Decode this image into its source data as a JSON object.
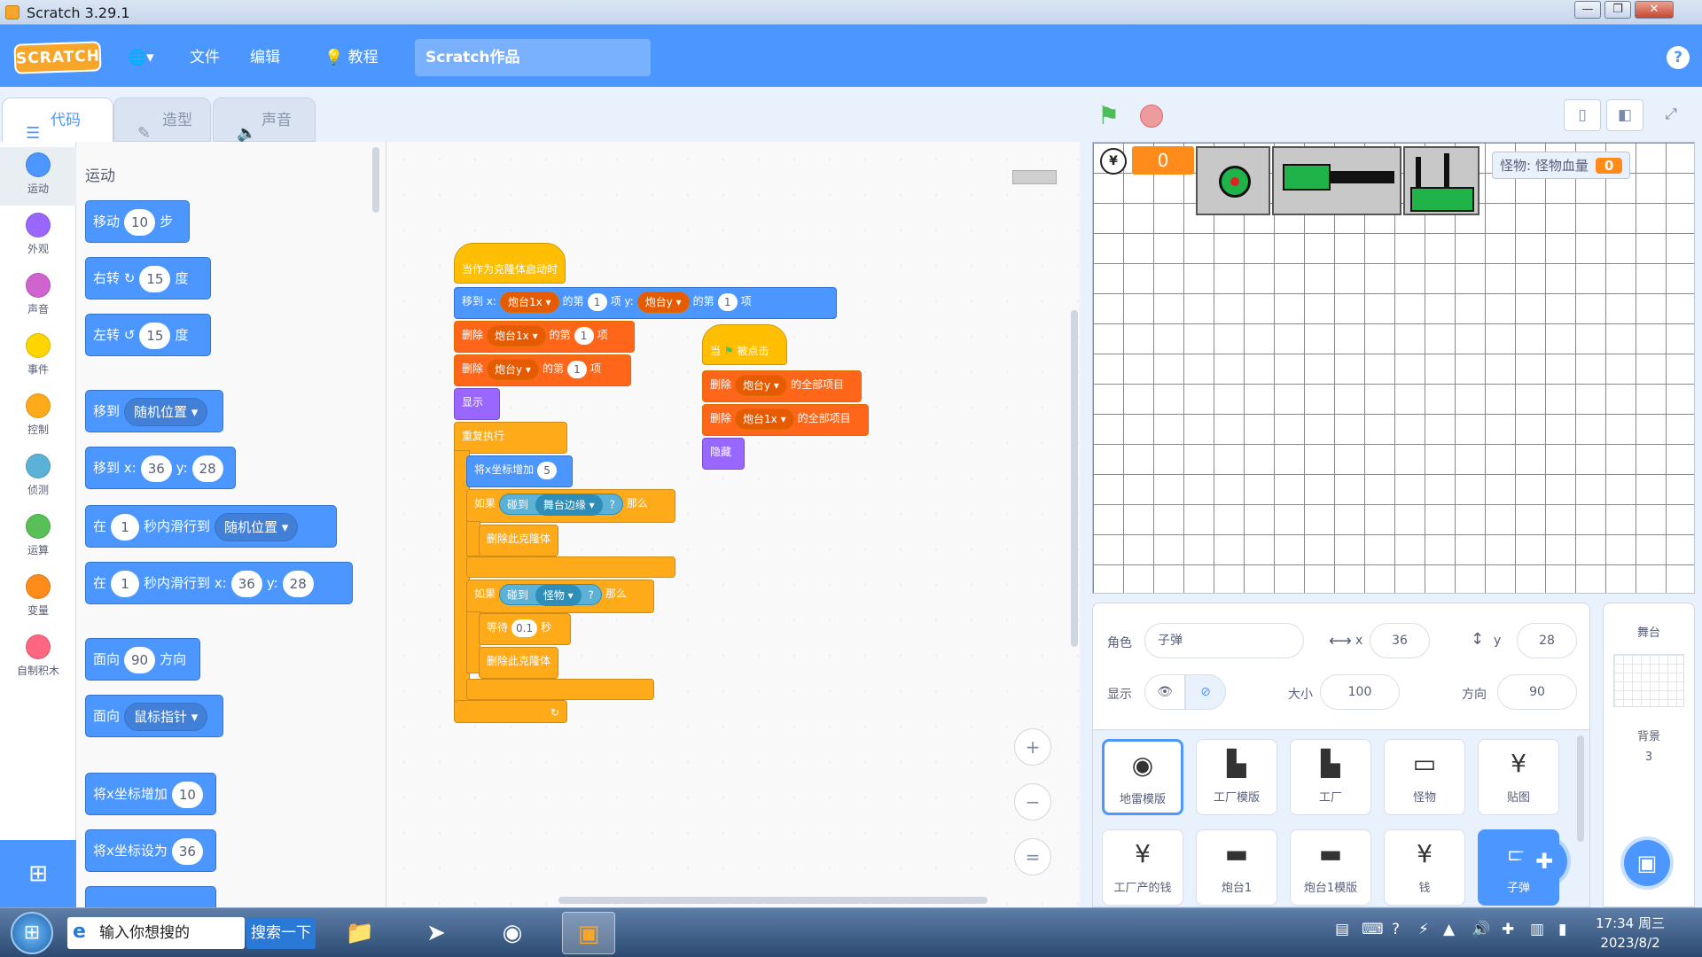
{
  "window": {
    "title": "Scratch 3.29.1",
    "minimize": "—",
    "restore": "❐",
    "close": "✕"
  },
  "menubar": {
    "logo": "SCRATCH",
    "globe": "🌐▾",
    "file": "文件",
    "edit": "编辑",
    "tutorials": "教程",
    "project_title": "Scratch作品",
    "help": "?"
  },
  "tabs": {
    "code": "代码",
    "costumes": "造型",
    "sounds": "声音"
  },
  "categories": [
    {
      "label": "运动",
      "color": "#4c97ff"
    },
    {
      "label": "外观",
      "color": "#9966ff"
    },
    {
      "label": "声音",
      "color": "#cf63cf"
    },
    {
      "label": "事件",
      "color": "#ffd500"
    },
    {
      "label": "控制",
      "color": "#ffab19"
    },
    {
      "label": "侦测",
      "color": "#5cb1d6"
    },
    {
      "label": "运算",
      "color": "#59c059"
    },
    {
      "label": "变量",
      "color": "#ff8c1a"
    },
    {
      "label": "自制积木",
      "color": "#ff6680"
    }
  ],
  "palette": {
    "heading": "运动",
    "move": {
      "a": "移动",
      "n": "10",
      "b": "步"
    },
    "turn_right": {
      "a": "右转",
      "icon": "↻",
      "n": "15",
      "b": "度"
    },
    "turn_left": {
      "a": "左转",
      "icon": "↺",
      "n": "15",
      "b": "度"
    },
    "goto": {
      "a": "移到",
      "drop": "随机位置 ▾"
    },
    "goto_xy": {
      "a": "移到 x:",
      "x": "36",
      "yl": "y:",
      "y": "28"
    },
    "glide": {
      "a": "在",
      "n": "1",
      "b": "秒内滑行到",
      "drop": "随机位置 ▾"
    },
    "glide_xy": {
      "a": "在",
      "n": "1",
      "b": "秒内滑行到 x:",
      "x": "36",
      "yl": "y:",
      "y": "28"
    },
    "point_dir": {
      "a": "面向",
      "n": "90",
      "b": "方向"
    },
    "point_towards": {
      "a": "面向",
      "drop": "鼠标指针 ▾"
    },
    "change_x": {
      "a": "将x坐标增加",
      "n": "10"
    },
    "set_x": {
      "a": "将x坐标设为",
      "n": "36"
    }
  },
  "script1": {
    "hat": "当作为克隆体启动时",
    "goto_a": "移到 x:",
    "goto_list1": "炮台1x ▾",
    "goto_of": "的第",
    "goto_n1": "1",
    "goto_item": "项",
    "goto_y": "y:",
    "goto_list2": "炮台y ▾",
    "goto_of2": "的第",
    "goto_n2": "1",
    "goto_item2": "项",
    "del1_a": "删除",
    "del1_list": "炮台1x ▾",
    "del1_of": "的第",
    "del1_n": "1",
    "del1_item": "项",
    "del2_a": "删除",
    "del2_list": "炮台y ▾",
    "del2_of": "的第",
    "del2_n": "1",
    "del2_item": "项",
    "show": "显示",
    "forever": "重复执行",
    "changex_a": "将x坐标增加",
    "changex_n": "5",
    "if1_a": "如果",
    "if1_sens": "碰到",
    "if1_drop": "舞台边缘 ▾",
    "if1_q": "?",
    "if1_then": "那么",
    "delclone1": "删除此克隆体",
    "if2_a": "如果",
    "if2_sens": "碰到",
    "if2_drop": "怪物 ▾",
    "if2_q": "?",
    "if2_then": "那么",
    "wait_a": "等待",
    "wait_n": "0.1",
    "wait_b": "秒",
    "delclone2": "删除此克隆体",
    "loop_arrow": "↻"
  },
  "script2": {
    "hat_a": "当",
    "hat_b": "被点击",
    "del1_a": "删除",
    "del1_list": "炮台y ▾",
    "del1_b": "的全部项目",
    "del2_a": "删除",
    "del2_list": "炮台1x ▾",
    "del2_b": "的全部项目",
    "hide": "隐藏"
  },
  "zoom": {
    "in": "+",
    "out": "−",
    "reset": "="
  },
  "stage": {
    "money_icon": "¥",
    "money_value": "0",
    "monster_label": "怪物: 怪物血量",
    "monster_value": "0"
  },
  "sprite_info": {
    "sprite_label": "角色",
    "sprite_name": "子弹",
    "x_label": "x",
    "x_value": "36",
    "y_label": "y",
    "y_value": "28",
    "show_label": "显示",
    "size_label": "大小",
    "size_value": "100",
    "direction_label": "方向",
    "direction_value": "90"
  },
  "sprites": [
    {
      "name": "地雷模版",
      "icon": "◉"
    },
    {
      "name": "工厂模版",
      "icon": "▙"
    },
    {
      "name": "工厂",
      "icon": "▙"
    },
    {
      "name": "怪物",
      "icon": "▭"
    },
    {
      "name": "贴图",
      "icon": "¥"
    },
    {
      "name": "工厂产的钱",
      "icon": "¥"
    },
    {
      "name": "炮台1",
      "icon": "▬"
    },
    {
      "name": "炮台1模版",
      "icon": "▬"
    },
    {
      "name": "钱",
      "icon": "¥"
    },
    {
      "name": "子弹",
      "icon": "▭"
    }
  ],
  "stage_panel": {
    "title": "舞台",
    "backdrops_label": "背景",
    "backdrops_count": "3"
  },
  "taskbar": {
    "search_placeholder": "输入你想搜的",
    "search_button": "搜索一下",
    "time": "17:34 周三",
    "date": "2023/8/2"
  }
}
